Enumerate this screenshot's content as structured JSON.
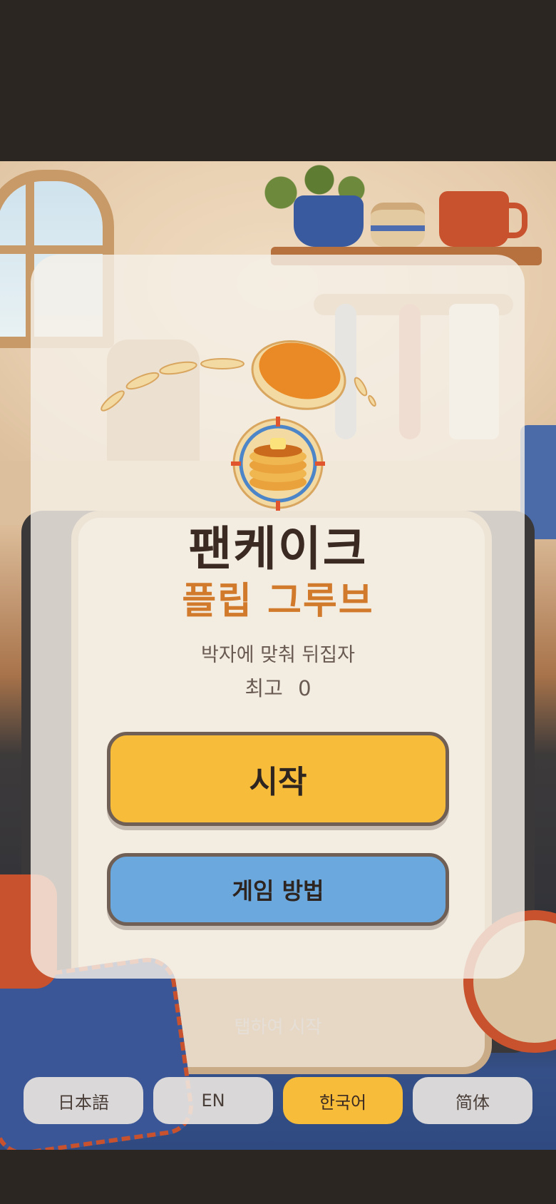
{
  "game": {
    "title_line1": "팬케이크",
    "title_line2": "플립 그루브",
    "subtitle": "박자에 맞춰 뒤집자",
    "best_label": "최고",
    "best_score": "0"
  },
  "buttons": {
    "start": "시작",
    "how_to_play": "게임 방법"
  },
  "hint": "탭하여 시작",
  "languages": [
    {
      "label": "日本語",
      "active": false
    },
    {
      "label": "EN",
      "active": false
    },
    {
      "label": "한국어",
      "active": true
    },
    {
      "label": "简体",
      "active": false
    }
  ],
  "colors": {
    "accent": "#f7bc3a",
    "secondary": "#6ba8dd",
    "title": "#3a2a22",
    "title_accent": "#d27a2c"
  }
}
